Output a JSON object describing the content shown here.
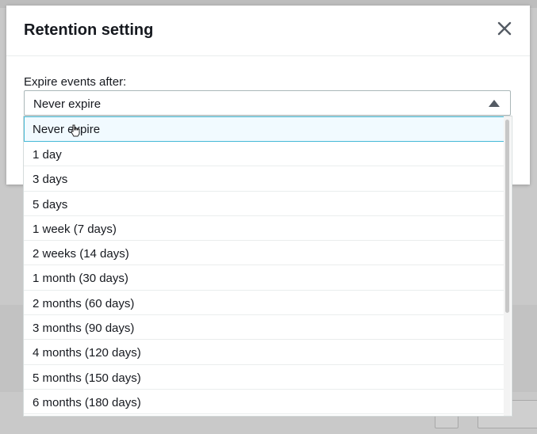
{
  "modal": {
    "title": "Retention setting",
    "field_label": "Expire events after:",
    "selected_value": "Never expire"
  },
  "options": [
    "Never expire",
    "1 day",
    "3 days",
    "5 days",
    "1 week (7 days)",
    "2 weeks (14 days)",
    "1 month (30 days)",
    "2 months (60 days)",
    "3 months (90 days)",
    "4 months (120 days)",
    "5 months (150 days)",
    "6 months (180 days)"
  ],
  "colors": {
    "selected_bg": "#f1faff",
    "selected_border": "#44b9d6",
    "text": "#16191f"
  }
}
